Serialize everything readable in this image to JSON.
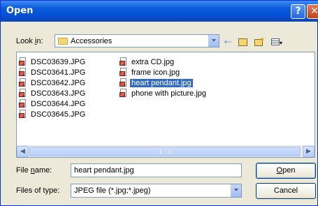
{
  "window": {
    "title": "Open"
  },
  "look_in": {
    "label_pre": "Look ",
    "label_mnemonic": "i",
    "label_post": "n:",
    "folder": "Accessories"
  },
  "toolbar": {
    "back_icon": "back-arrow-icon",
    "up_icon": "up-folder-icon",
    "new_folder_icon": "new-folder-icon",
    "views_icon": "views-menu-icon"
  },
  "files": {
    "column1": [
      "DSC03639.JPG",
      "DSC03641.JPG",
      "DSC03642.JPG",
      "DSC03643.JPG",
      "DSC03644.JPG",
      "DSC03645.JPG"
    ],
    "column2": [
      "extra CD.jpg",
      "frame icon.jpg",
      "heart pendant.jpg",
      "phone with picture.jpg"
    ],
    "selected": "heart pendant.jpg"
  },
  "file_name": {
    "label_pre": "File ",
    "label_mnemonic": "n",
    "label_post": "ame:",
    "value": "heart pendant.jpg"
  },
  "file_type": {
    "label": "Files of type:",
    "value": "JPEG file (*.jpg;*.jpeg)"
  },
  "buttons": {
    "open_mnemonic": "O",
    "open_rest": "pen",
    "cancel": "Cancel"
  },
  "colors": {
    "titlebar": "#0550d4",
    "selection": "#316ac5",
    "dialog_bg": "#ece9d8"
  }
}
